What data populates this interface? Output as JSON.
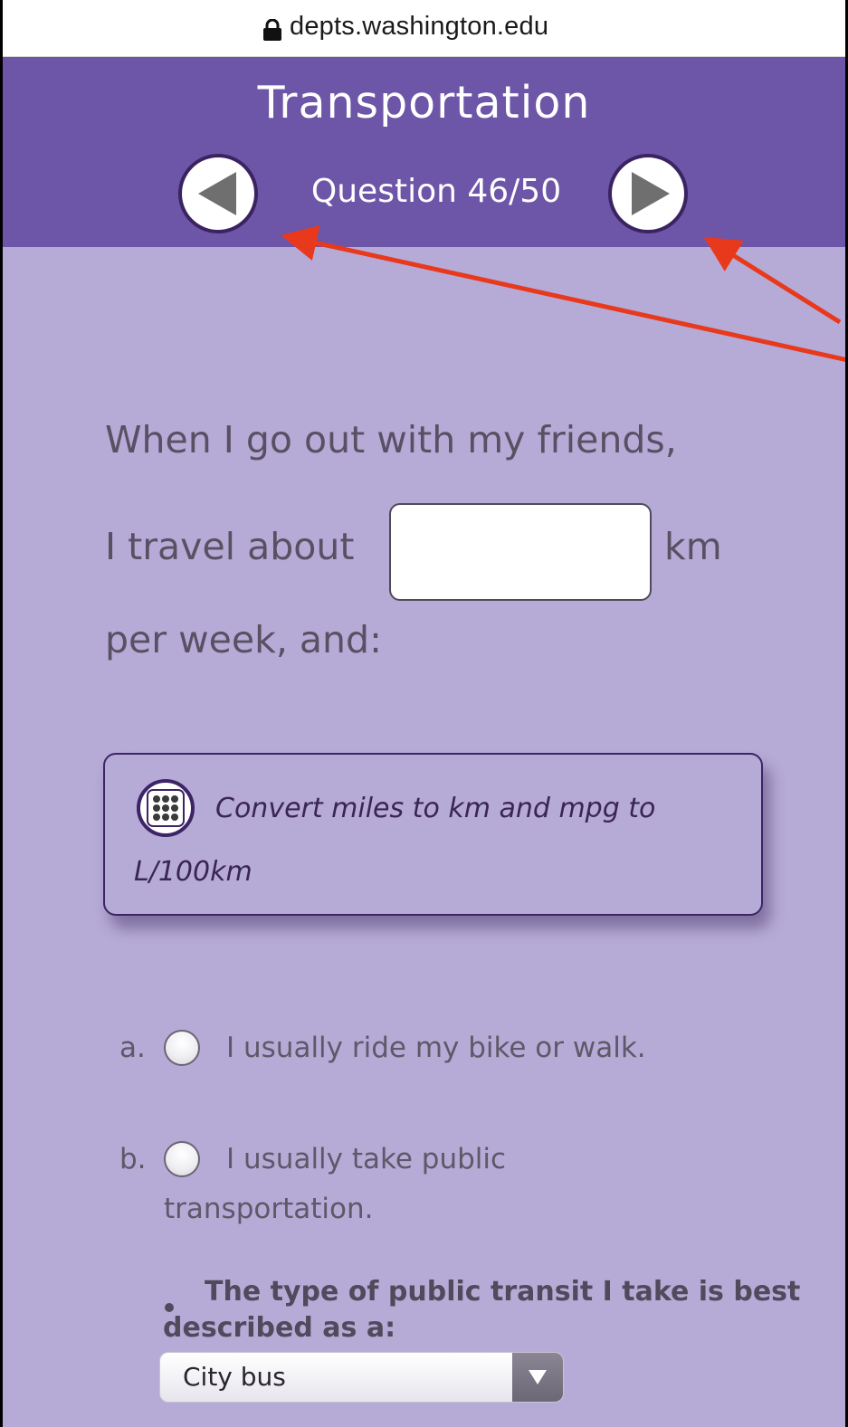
{
  "browser": {
    "url": "depts.washington.edu",
    "lock_icon": "lock-icon"
  },
  "header": {
    "title": "Transportation",
    "question_counter": "Question 46/50",
    "prev_icon": "left-triangle-icon",
    "next_icon": "right-triangle-icon"
  },
  "question": {
    "line1": "When I go out with my friends,",
    "line2": "I travel about",
    "input_value": "",
    "unit": "km",
    "line3": "per week, and:"
  },
  "converter": {
    "icon": "calculator-icon",
    "line1": "Convert miles to km and mpg to",
    "line2": "L/100km"
  },
  "options": [
    {
      "letter": "a.",
      "text": "I usually ride my bike or walk.",
      "selected": false
    },
    {
      "letter": "b.",
      "text_line1": "I usually take public",
      "text_line2": "transportation.",
      "selected": false
    }
  ],
  "sub_question": {
    "line1": "The type of public transit I take is best",
    "line2": "described as a:",
    "select_value": "City bus"
  },
  "colors": {
    "header_bg": "#6d55a7",
    "page_bg": "#b6abd7",
    "annotation": "#e8391d"
  }
}
